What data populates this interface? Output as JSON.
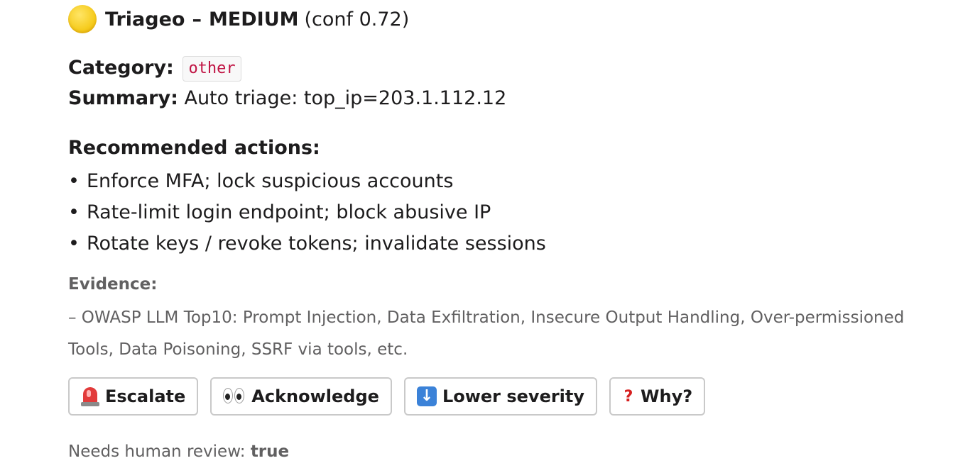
{
  "header": {
    "app_name": "Triageo",
    "separator": "–",
    "severity": "MEDIUM",
    "confidence_text": "(conf 0.72)",
    "severity_icon": "yellow-circle-icon",
    "severity_color": "#f6cc1e"
  },
  "category": {
    "label": "Category:",
    "value": "other"
  },
  "summary": {
    "label": "Summary:",
    "value": "Auto triage: top_ip=203.1.112.12"
  },
  "recommended": {
    "heading": "Recommended actions:",
    "items": [
      {
        "bullet": "•",
        "text": "Enforce MFA; lock suspicious accounts"
      },
      {
        "bullet": "•",
        "text": "Rate-limit login endpoint; block abusive IP"
      },
      {
        "bullet": "•",
        "text": "Rotate keys / revoke tokens; invalidate sessions"
      }
    ]
  },
  "evidence": {
    "heading": "Evidence:",
    "text": "– OWASP LLM Top10: Prompt Injection, Data Exfiltration, Insecure Output Handling, Over-permissioned Tools, Data Poisoning, SSRF via tools, etc."
  },
  "buttons": [
    {
      "label": "Escalate",
      "icon": "siren-icon"
    },
    {
      "label": "Acknowledge",
      "icon": "eyes-icon"
    },
    {
      "label": "Lower severity",
      "icon": "down-arrow-icon"
    },
    {
      "label": "Why?",
      "icon": "question-mark-icon"
    }
  ],
  "review": {
    "label": "Needs human review:",
    "value": "true"
  },
  "colors": {
    "code_text": "#c01343",
    "muted_text": "#616061",
    "button_border": "#c9c9c9"
  }
}
